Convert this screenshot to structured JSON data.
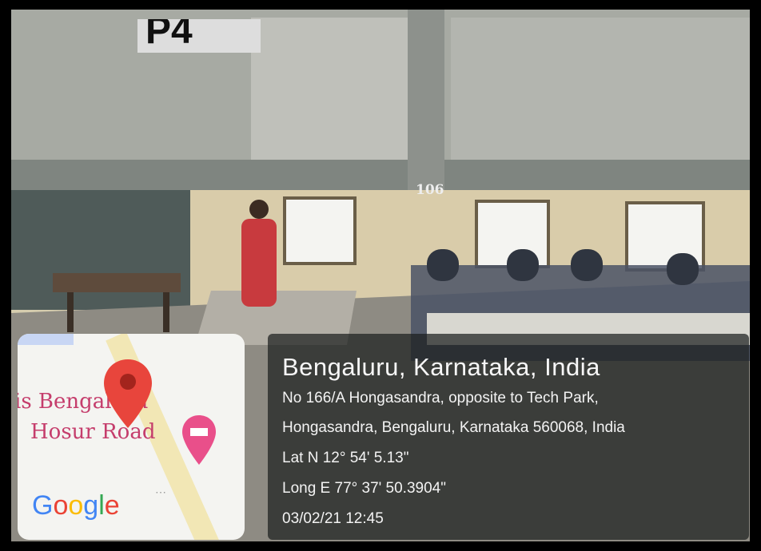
{
  "photo": {
    "room_number": "106",
    "door_sign": "P4"
  },
  "map": {
    "place_label_line1": "is Bengaluru",
    "place_label_line2": "Hosur Road",
    "brand_letters": [
      "G",
      "o",
      "o",
      "g",
      "l",
      "e"
    ],
    "brand_colors": [
      "#4285F4",
      "#EA4335",
      "#FBBC05",
      "#4285F4",
      "#34A853",
      "#EA4335"
    ],
    "pin_color": "#e8453c",
    "hotel_pin_color": "#e94f8a",
    "more_icon": "ellipsis-icon"
  },
  "location": {
    "city": "Bengaluru, Karnataka, India",
    "address_line1": "No 166/A Hongasandra, opposite to Tech Park,",
    "address_line2": "Hongasandra, Bengaluru, Karnataka 560068, India",
    "latitude": "Lat N 12° 54' 5.13\"",
    "longitude": "Long E 77° 37' 50.3904\"",
    "timestamp": "03/02/21 12:45"
  }
}
